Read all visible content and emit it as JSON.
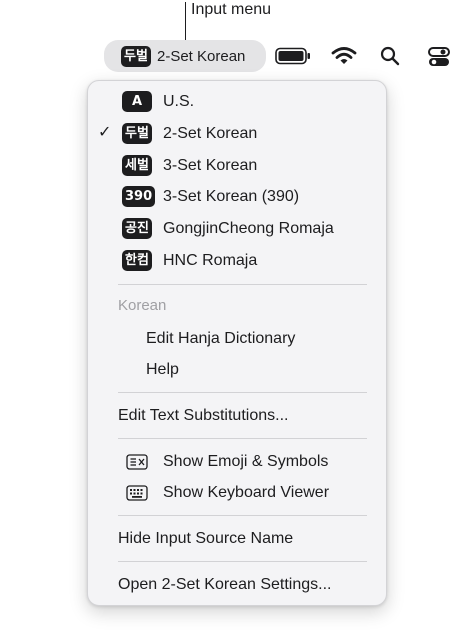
{
  "callout": {
    "label": "Input menu"
  },
  "menubar": {
    "input_badge": "두벌",
    "input_label": "2-Set Korean"
  },
  "menu": {
    "sources": [
      {
        "badge": "A",
        "label": "U.S.",
        "checked": false
      },
      {
        "badge": "두벌",
        "label": "2-Set Korean",
        "checked": true
      },
      {
        "badge": "세벌",
        "label": "3-Set Korean",
        "checked": false
      },
      {
        "badge": "390",
        "label": "3-Set Korean (390)",
        "checked": false
      },
      {
        "badge": "공진",
        "label": "GongjinCheong Romaja",
        "checked": false
      },
      {
        "badge": "한컴",
        "label": "HNC Romaja",
        "checked": false
      }
    ],
    "check_mark": "✓",
    "section_header": "Korean",
    "edit_hanja": "Edit Hanja Dictionary",
    "help": "Help",
    "edit_text_substitutions": "Edit Text Substitutions...",
    "show_emoji": "Show Emoji & Symbols",
    "show_keyboard_viewer": "Show Keyboard Viewer",
    "hide_input_source_name": "Hide Input Source Name",
    "open_settings": "Open 2-Set Korean Settings..."
  },
  "icons": {
    "battery": "battery-icon",
    "wifi": "wifi-icon",
    "search": "search-icon",
    "control_center": "control-center-icon",
    "emoji": "emoji-symbols-icon",
    "keyboard": "keyboard-viewer-icon"
  },
  "colors": {
    "menu_background": "#f4f4f6",
    "highlight_pill": "#e4e4e6",
    "badge_background": "#1d1d1f",
    "section_header": "#a0a0a4"
  }
}
